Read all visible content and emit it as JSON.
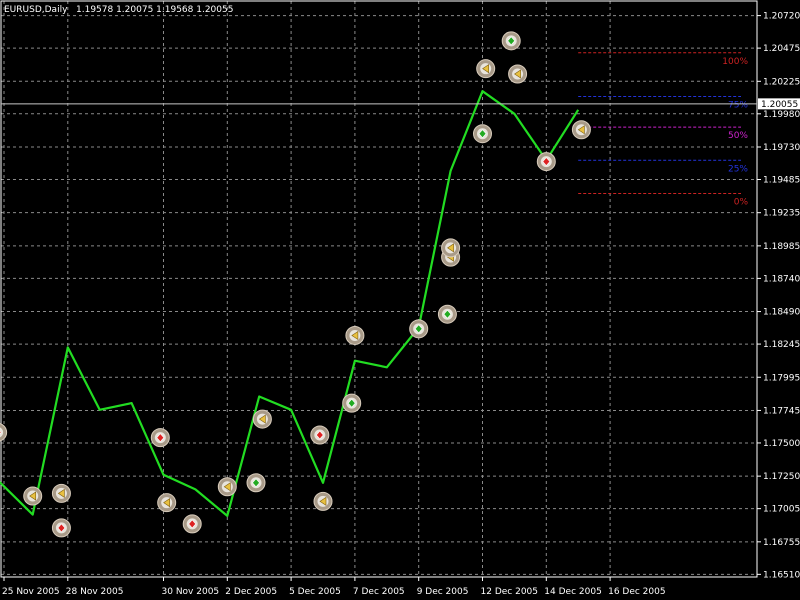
{
  "chart_data": {
    "type": "line",
    "title": "EURUSD,Daily",
    "ohlc_readout": "1.19578 1.20075 1.19568 1.20055",
    "current_price": "1.20055",
    "ylim": [
      1.1649,
      1.2083
    ],
    "y_ticks": [
      "1.20720",
      "1.20475",
      "1.20225",
      "1.19980",
      "1.19730",
      "1.19485",
      "1.19235",
      "1.18985",
      "1.18740",
      "1.18490",
      "1.18245",
      "1.17995",
      "1.17745",
      "1.17500",
      "1.17250",
      "1.17005",
      "1.16755",
      "1.16510"
    ],
    "x_ticks": [
      {
        "label": "25 Nov 2005",
        "index": 0
      },
      {
        "label": "28 Nov 2005",
        "index": 1
      },
      {
        "label": "30 Nov 2005",
        "index": 2.5
      },
      {
        "label": "2 Dec 2005",
        "index": 3.5
      },
      {
        "label": "5 Dec 2005",
        "index": 4.5
      },
      {
        "label": "7 Dec 2005",
        "index": 5.5
      },
      {
        "label": "9 Dec 2005",
        "index": 6.5
      },
      {
        "label": "12 Dec 2005",
        "index": 7.5
      },
      {
        "label": "14 Dec 2005",
        "index": 8.5
      },
      {
        "label": "16 Dec 2005",
        "index": 9.5
      }
    ],
    "grid": true,
    "series": [
      {
        "color": "#22dd22",
        "points": [
          [
            -0.1,
            1.1722
          ],
          [
            0.45,
            1.1696
          ],
          [
            1.0,
            1.1822
          ],
          [
            1.5,
            1.1775
          ],
          [
            2.0,
            1.178
          ],
          [
            2.5,
            1.1726
          ],
          [
            3.0,
            1.1715
          ],
          [
            3.5,
            1.1695
          ],
          [
            4.0,
            1.1785
          ],
          [
            4.5,
            1.1775
          ],
          [
            5.0,
            1.172
          ],
          [
            5.5,
            1.1812
          ],
          [
            6.0,
            1.1807
          ],
          [
            6.5,
            1.1837
          ],
          [
            7.0,
            1.1955
          ],
          [
            7.5,
            1.2015
          ],
          [
            8.0,
            1.1998
          ],
          [
            8.5,
            1.1963
          ],
          [
            9.0,
            1.2001
          ]
        ]
      }
    ],
    "fibonacci_levels": [
      {
        "label": "100%",
        "value": 1.2044,
        "color": "#cc2222"
      },
      {
        "label": "75%",
        "value": 1.2011,
        "color": "#2233dd"
      },
      {
        "label": "50%",
        "value": 1.1988,
        "color": "#cc22cc"
      },
      {
        "label": "25%",
        "value": 1.1963,
        "color": "#2233dd"
      },
      {
        "label": "0%",
        "value": 1.1938,
        "color": "#cc2222"
      }
    ],
    "markers": [
      {
        "x": -0.1,
        "y": 1.1758,
        "kind": "buy"
      },
      {
        "x": 0.45,
        "y": 1.171,
        "kind": "sell"
      },
      {
        "x": 0.9,
        "y": 1.1712,
        "kind": "sell"
      },
      {
        "x": 0.9,
        "y": 1.1686,
        "kind": "buy"
      },
      {
        "x": 2.45,
        "y": 1.1754,
        "kind": "buy"
      },
      {
        "x": 2.55,
        "y": 1.1705,
        "kind": "sell"
      },
      {
        "x": 2.95,
        "y": 1.1689,
        "kind": "buy"
      },
      {
        "x": 3.5,
        "y": 1.1717,
        "kind": "sell"
      },
      {
        "x": 3.95,
        "y": 1.172,
        "kind": "close"
      },
      {
        "x": 4.05,
        "y": 1.1768,
        "kind": "sell"
      },
      {
        "x": 4.95,
        "y": 1.1756,
        "kind": "buy"
      },
      {
        "x": 5.0,
        "y": 1.1706,
        "kind": "sell"
      },
      {
        "x": 5.45,
        "y": 1.178,
        "kind": "close"
      },
      {
        "x": 5.5,
        "y": 1.1831,
        "kind": "sell"
      },
      {
        "x": 6.5,
        "y": 1.1836,
        "kind": "close"
      },
      {
        "x": 6.95,
        "y": 1.1847,
        "kind": "close"
      },
      {
        "x": 7.0,
        "y": 1.189,
        "kind": "sell"
      },
      {
        "x": 7.0,
        "y": 1.1897,
        "kind": "sell"
      },
      {
        "x": 7.5,
        "y": 1.1983,
        "kind": "close"
      },
      {
        "x": 7.55,
        "y": 1.2032,
        "kind": "sell"
      },
      {
        "x": 7.95,
        "y": 1.2053,
        "kind": "close"
      },
      {
        "x": 8.05,
        "y": 1.2028,
        "kind": "sell"
      },
      {
        "x": 8.5,
        "y": 1.1962,
        "kind": "buy"
      },
      {
        "x": 9.05,
        "y": 1.1986,
        "kind": "sell"
      }
    ]
  }
}
